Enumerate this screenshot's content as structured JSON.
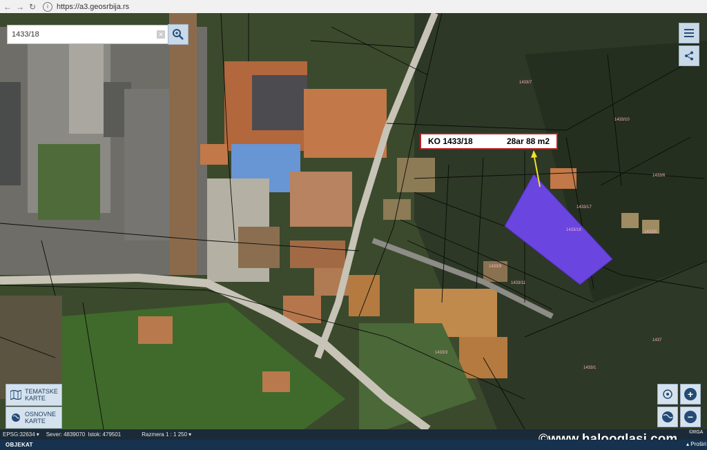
{
  "browser": {
    "url": "https://a3.geosrbija.rs"
  },
  "search": {
    "value": "1433/18"
  },
  "callout": {
    "parcel": "KO 1433/18",
    "area": "28ar 88 m2"
  },
  "left_panel": {
    "tematske": "TEMATSKE KARTE",
    "osnovne": "OSNOVNE KARTE"
  },
  "status": {
    "epsg": "EPSG:32634",
    "sever": "Sever: 4839070",
    "istok": "Istok: 479501",
    "razmera": "Razmera 1 : 1 250"
  },
  "bottom": {
    "tab": "OBJEKAT",
    "expand": "Proširi",
    "copyright": "©RGA"
  },
  "watermark": "©www.halooglasi.com",
  "parcel_labels": [
    "1433/7",
    "1433/18",
    "1433/17",
    "1433/6",
    "1433/10",
    "1433/5",
    "1433/9",
    "1433/11",
    "1433/3",
    "1437",
    "1433/1"
  ],
  "colors": {
    "highlight": "#6a45e0",
    "callout_border": "#b52121",
    "arrow": "#f3e32a",
    "button_bg": "#c9d9e8",
    "status_bg": "#1b2a38"
  },
  "icons": {
    "search": "search-location-icon",
    "menu": "hamburger-icon",
    "share": "share-icon",
    "map": "map-icon",
    "globe": "globe-icon",
    "zoom_in": "plus-icon",
    "zoom_out": "minus-icon",
    "locate": "crosshair-icon"
  }
}
